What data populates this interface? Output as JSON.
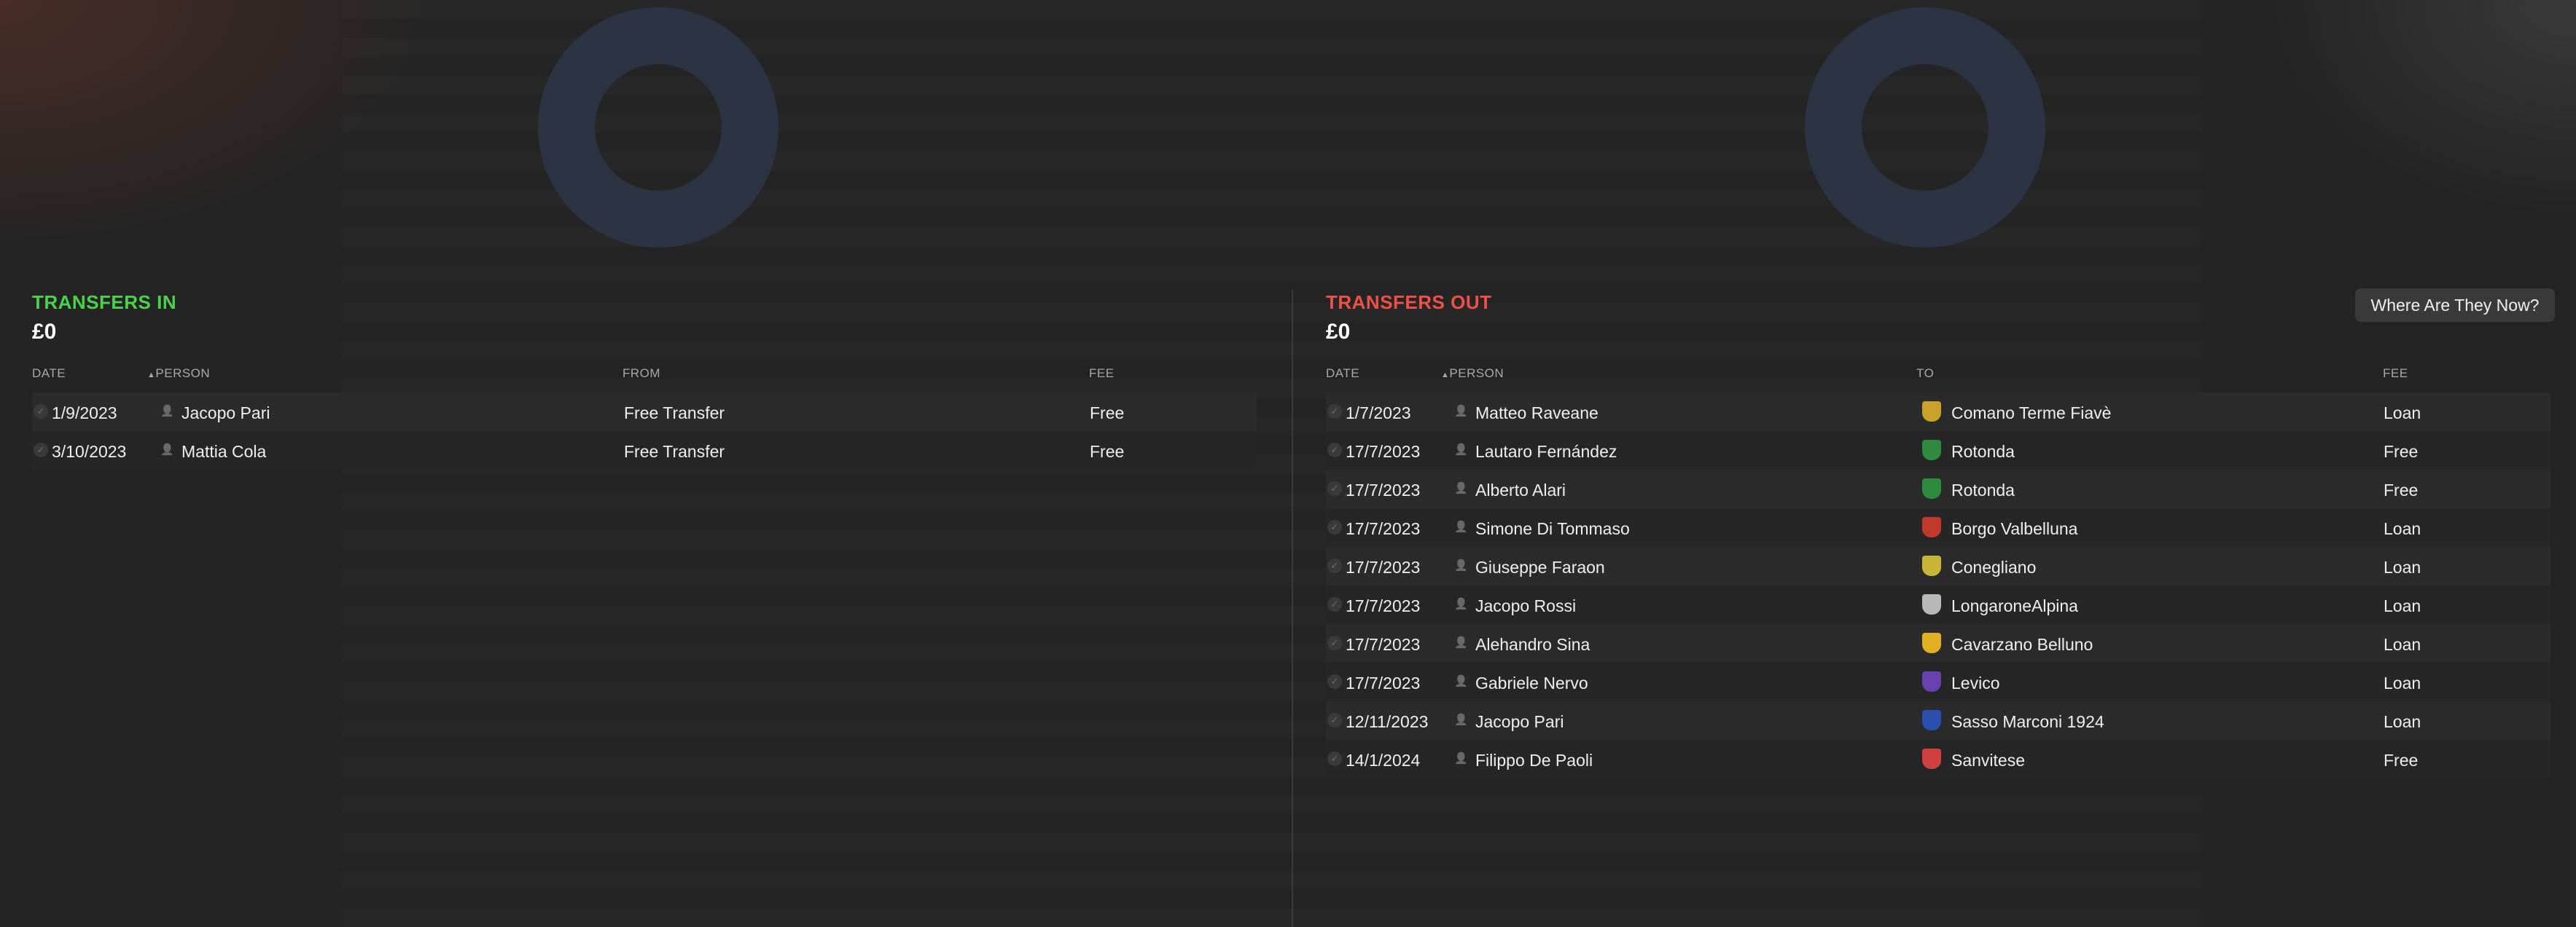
{
  "transfers_in": {
    "title": "TRANSFERS IN",
    "total": "£0",
    "columns": {
      "date": "DATE",
      "person": "PERSON",
      "from": "FROM",
      "fee": "FEE"
    },
    "rows": [
      {
        "date": "1/9/2023",
        "person": "Jacopo Pari",
        "from": "Free Transfer",
        "fee": "Free"
      },
      {
        "date": "3/10/2023",
        "person": "Mattia Cola",
        "from": "Free Transfer",
        "fee": "Free"
      }
    ]
  },
  "transfers_out": {
    "title": "TRANSFERS OUT",
    "total": "£0",
    "where_button": "Where Are They Now?",
    "columns": {
      "date": "DATE",
      "person": "PERSON",
      "to": "TO",
      "fee": "FEE"
    },
    "rows": [
      {
        "date": "1/7/2023",
        "person": "Matteo Raveane",
        "to": "Comano Terme Fiavè",
        "fee": "Loan",
        "crest_color": "#c9a02a"
      },
      {
        "date": "17/7/2023",
        "person": "Lautaro Fernández",
        "to": "Rotonda",
        "fee": "Free",
        "crest_color": "#2e8a3e"
      },
      {
        "date": "17/7/2023",
        "person": "Alberto Alari",
        "to": "Rotonda",
        "fee": "Free",
        "crest_color": "#2e8a3e"
      },
      {
        "date": "17/7/2023",
        "person": "Simone Di Tommaso",
        "to": "Borgo Valbelluna",
        "fee": "Loan",
        "crest_color": "#c0392b"
      },
      {
        "date": "17/7/2023",
        "person": "Giuseppe Faraon",
        "to": "Conegliano",
        "fee": "Loan",
        "crest_color": "#c9b43a"
      },
      {
        "date": "17/7/2023",
        "person": "Jacopo Rossi",
        "to": "LongaroneAlpina",
        "fee": "Loan",
        "crest_color": "#b8b8b8"
      },
      {
        "date": "17/7/2023",
        "person": "Alehandro Sina",
        "to": "Cavarzano Belluno",
        "fee": "Loan",
        "crest_color": "#e0b020"
      },
      {
        "date": "17/7/2023",
        "person": "Gabriele Nervo",
        "to": "Levico",
        "fee": "Loan",
        "crest_color": "#6a3fb0"
      },
      {
        "date": "12/11/2023",
        "person": "Jacopo Pari",
        "to": "Sasso Marconi 1924",
        "fee": "Loan",
        "crest_color": "#2a4fb0"
      },
      {
        "date": "14/1/2024",
        "person": "Filippo De Paoli",
        "to": "Sanvitese",
        "fee": "Free",
        "crest_color": "#d04040"
      }
    ]
  },
  "icons": {
    "check": "check-icon",
    "person": "person-icon",
    "sort_up": "sort-up-icon"
  }
}
